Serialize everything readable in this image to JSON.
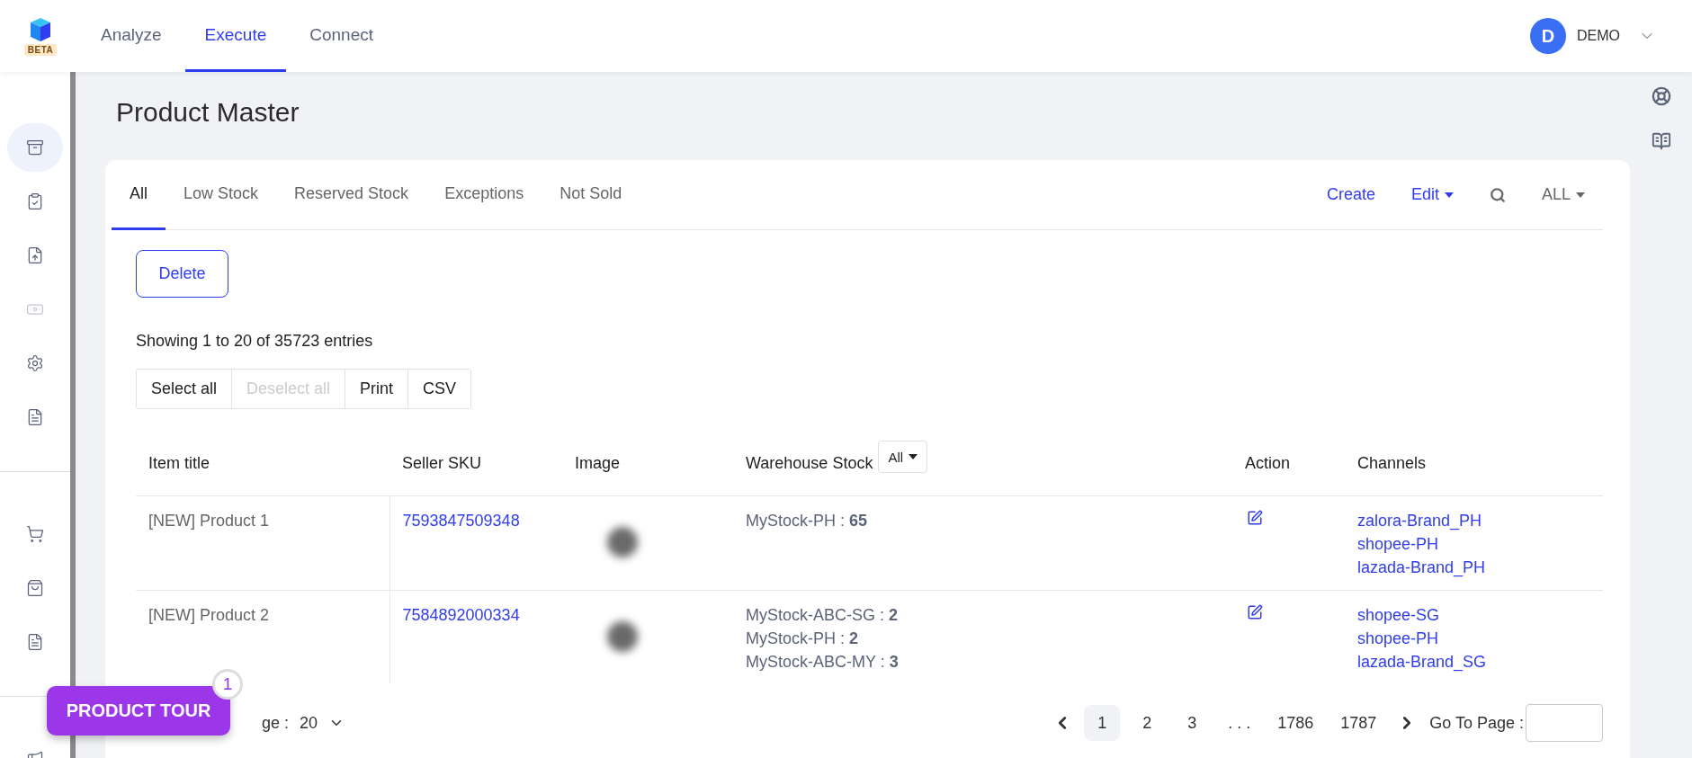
{
  "brand": {
    "badge": "BETA"
  },
  "nav_tabs": [
    {
      "label": "Analyze",
      "selected": false
    },
    {
      "label": "Execute",
      "selected": true
    },
    {
      "label": "Connect",
      "selected": false
    }
  ],
  "user": {
    "initial": "D",
    "name": "DEMO"
  },
  "sidebar": {
    "groups": [
      {
        "items": [
          {
            "kind": "archive",
            "selected": true,
            "disabled": false
          },
          {
            "kind": "clipboard",
            "selected": false,
            "disabled": false
          },
          {
            "kind": "upload",
            "selected": false,
            "disabled": false
          },
          {
            "kind": "money",
            "selected": false,
            "disabled": true
          },
          {
            "kind": "settings",
            "selected": false,
            "disabled": false
          },
          {
            "kind": "document",
            "selected": false,
            "disabled": false
          }
        ]
      },
      {
        "items": [
          {
            "kind": "cart",
            "selected": false,
            "disabled": false
          },
          {
            "kind": "bag",
            "selected": false,
            "disabled": false
          },
          {
            "kind": "document",
            "selected": false,
            "disabled": false
          }
        ]
      },
      {
        "items": [
          {
            "kind": "megaphone",
            "selected": false,
            "disabled": false
          }
        ]
      }
    ]
  },
  "page_title": "Product Master",
  "filter_tabs": [
    {
      "label": "All",
      "selected": true
    },
    {
      "label": "Low Stock",
      "selected": false
    },
    {
      "label": "Reserved Stock",
      "selected": false
    },
    {
      "label": "Exceptions",
      "selected": false
    },
    {
      "label": "Not Sold",
      "selected": false
    }
  ],
  "toolbar": {
    "create": "Create",
    "edit": "Edit",
    "scope": "ALL"
  },
  "delete_button": "Delete",
  "summary": "Showing 1 to 20 of 35723 entries",
  "export_buttons": [
    {
      "label": "Select all",
      "disabled": false
    },
    {
      "label": "Deselect all",
      "disabled": true
    },
    {
      "label": "Print",
      "disabled": false
    },
    {
      "label": "CSV",
      "disabled": false
    }
  ],
  "table": {
    "columns": [
      {
        "label": "Item title",
        "kind": "text"
      },
      {
        "label": "Seller SKU",
        "kind": "text"
      },
      {
        "label": "Image",
        "kind": "text"
      },
      {
        "label": "Warehouse Stock",
        "kind": "filter",
        "filter": "All"
      },
      {
        "label": "Action",
        "kind": "text"
      },
      {
        "label": "Channels",
        "kind": "text"
      }
    ],
    "rows": [
      {
        "title": "[NEW] Product 1",
        "sku": "7593847509348",
        "stock": [
          "MyStock-PH : **65**"
        ],
        "channels": [
          "zalora-Brand_PH",
          "shopee-PH",
          "lazada-Brand_PH"
        ]
      },
      {
        "title": "[NEW] Product 2",
        "sku": "7584892000334",
        "stock": [
          "MyStock-ABC-SG : **2**",
          "MyStock-PH : **2**",
          "MyStock-ABC-MY : **3**"
        ],
        "channels": [
          "shopee-SG",
          "shopee-PH",
          "lazada-Brand_SG"
        ]
      }
    ]
  },
  "pagination": {
    "rows_label": "ge :",
    "rows_value": "20",
    "pages": [
      {
        "label": "1",
        "selected": true
      },
      {
        "label": "2",
        "selected": false
      },
      {
        "label": "3",
        "selected": false
      },
      {
        "label": ". . .",
        "selected": false
      },
      {
        "label": "1786",
        "selected": false
      },
      {
        "label": "1787",
        "selected": false
      }
    ],
    "goto_label": "Go To Page :"
  },
  "product_tour": {
    "label": "PRODUCT TOUR",
    "badge": "1"
  }
}
